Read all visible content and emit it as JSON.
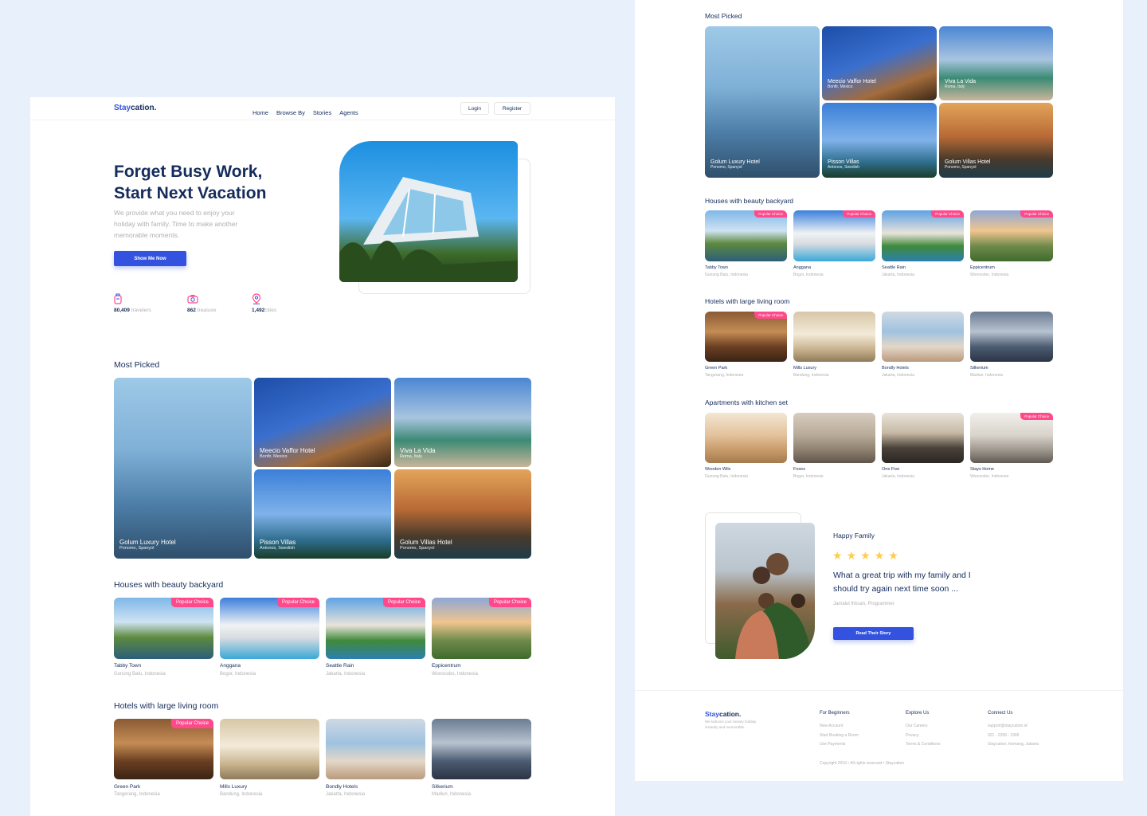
{
  "brand": {
    "part1": "Stay",
    "part2": "cation."
  },
  "nav": {
    "items": [
      "Home",
      "Browse By",
      "Stories",
      "Agents"
    ],
    "login": "Login",
    "register": "Register"
  },
  "hero": {
    "title_line1": "Forget Busy Work,",
    "title_line2": "Start Next Vacation",
    "subtitle_line1": "We provide what you need to enjoy your",
    "subtitle_line2": "holiday with family. Time to make another",
    "subtitle_line3": "memorable moments.",
    "cta": "Show Me Now"
  },
  "stats": [
    {
      "value": "80,409",
      "label": "travelers",
      "icon": "traveler-icon"
    },
    {
      "value": "862",
      "label": "treasure",
      "icon": "camera-icon"
    },
    {
      "value": "1,492",
      "label": "cities",
      "icon": "location-pin-icon"
    }
  ],
  "most_picked": {
    "title": "Most Picked",
    "items": [
      {
        "name": "Golum Luxury Hotel",
        "location": "Ponomo, Spanyol"
      },
      {
        "name": "Meecio Vaffor Hotel",
        "location": "Bonfir, Mexico"
      },
      {
        "name": "Viva La Vida",
        "location": "Roma, Italy"
      },
      {
        "name": "Pisson Villas",
        "location": "Antonos, Swedish"
      },
      {
        "name": "Golum Villas Hotel",
        "location": "Ponomo, Spanyol"
      }
    ]
  },
  "badge": "Popular Choice",
  "backyard": {
    "title": "Houses with beauty backyard",
    "items": [
      {
        "name": "Tabby Town",
        "location": "Gunung Batu, Indonesia"
      },
      {
        "name": "Anggana",
        "location": "Bogor, Indonesia"
      },
      {
        "name": "Seattle Rain",
        "location": "Jakarta, Indonesia"
      },
      {
        "name": "Eppicentrum",
        "location": "Wonosobo, Indonesia"
      }
    ]
  },
  "living": {
    "title": "Hotels with large living room",
    "items": [
      {
        "name": "Green Park",
        "location": "Tangerang, Indonesia"
      },
      {
        "name": "Mills Luxury",
        "location": "Bandung, Indonesia"
      },
      {
        "name": "Bondly Hotels",
        "location": "Jakarta, Indonesia"
      },
      {
        "name": "Silkerium",
        "location": "Madiun, Indonesia"
      }
    ]
  },
  "kitchen": {
    "title": "Apartments with kitchen set",
    "items": [
      {
        "name": "Wooden Wils",
        "location": "Gunung Batu, Indonesia"
      },
      {
        "name": "Foxes",
        "location": "Bogor, Indonesia"
      },
      {
        "name": "One Five",
        "location": "Jakarta, Indonesia"
      },
      {
        "name": "Stays Home",
        "location": "Wonosobo, Indonesia"
      }
    ]
  },
  "testimonial": {
    "title": "Happy Family",
    "rating": 5,
    "quote_line1": "What a great trip with my family and I",
    "quote_line2": "should try again next time soon ...",
    "author": "Jamalul Ihksan, Programmer",
    "cta": "Read Their Story"
  },
  "footer": {
    "tagline_line1": "We kaboom your beauty holiday",
    "tagline_line2": "instantly and memorable.",
    "col1": {
      "title": "For Beginners",
      "links": [
        "New Account",
        "Start Booking a Room",
        "Use Payments"
      ]
    },
    "col2": {
      "title": "Explore Us",
      "links": [
        "Our Careers",
        "Privacy",
        "Terms & Conditions"
      ]
    },
    "col3": {
      "title": "Connect Us",
      "links": [
        "support@staycation.id",
        "021 - 2208 - 1996",
        "Staycation, Kemang, Jakarta"
      ]
    },
    "copyright": "Copyright 2019 • All rights reserved • Staycation"
  },
  "colors": {
    "primary": "#3252df",
    "navy": "#152c5b",
    "muted": "#b0b0b0",
    "badge": "#ff498b",
    "star": "#ffcc47",
    "background": "#e8f0fb"
  }
}
